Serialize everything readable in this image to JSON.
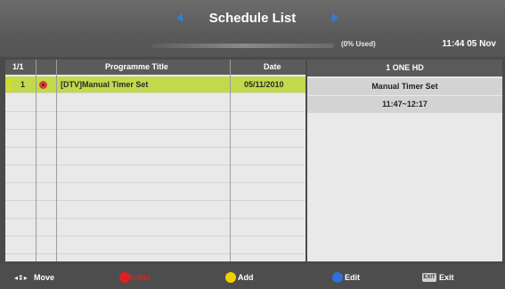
{
  "header": {
    "title": "Schedule List",
    "usage": "(0% Used)",
    "clock": "11:44 05 Nov"
  },
  "table": {
    "headers": {
      "index": "1/1",
      "title": "Programme Title",
      "date": "Date"
    },
    "rows": [
      {
        "num": "1",
        "title": "[DTV]Manual Timer Set",
        "date": "05/11/2010",
        "selected": true
      }
    ],
    "empty_row_count": 9
  },
  "info": {
    "channel": "1 ONE HD",
    "programme": "Manual Timer Set",
    "time": "11:47~12:17"
  },
  "footer": {
    "move": "Move",
    "delete": "Delete",
    "add": "Add",
    "edit": "Edit",
    "exit": "Exit",
    "exit_key": "EXIT"
  },
  "colors": {
    "selected_row": "#c2d94b",
    "nav_arrow": "#2f7fd8",
    "red_key": "#e02020",
    "yellow_key": "#f0d000",
    "blue_key": "#2f6fd8"
  }
}
